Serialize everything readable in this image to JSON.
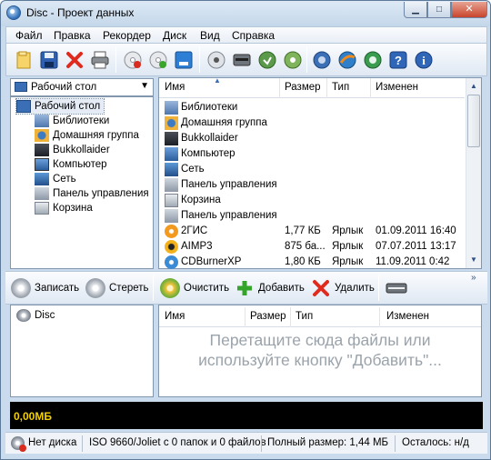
{
  "window": {
    "title": "Disc - Проект данных",
    "min": "▁",
    "max": "□",
    "close": "✕"
  },
  "menu": [
    "Файл",
    "Правка",
    "Рекордер",
    "Диск",
    "Вид",
    "Справка"
  ],
  "toolbar_icons": [
    "new-folder-icon",
    "save-icon",
    "delete-icon",
    "print-icon",
    "burn-disc-icon",
    "blank-disc-icon",
    "drive-icon",
    "disc-info-icon",
    "recorder-icon",
    "copy-disc-icon",
    "rip-disc-icon",
    "settings-icon",
    "web-icon",
    "update-icon",
    "help-icon",
    "info-icon"
  ],
  "location": {
    "selected": "Рабочий стол"
  },
  "tree": [
    {
      "label": "Рабочий стол",
      "icon": "desktop-icon",
      "selected": true
    },
    {
      "label": "Библиотеки",
      "icon": "libraries-icon"
    },
    {
      "label": "Домашняя группа",
      "icon": "homegroup-icon"
    },
    {
      "label": "Bukkollaider",
      "icon": "user-folder-icon"
    },
    {
      "label": "Компьютер",
      "icon": "computer-icon"
    },
    {
      "label": "Сеть",
      "icon": "network-icon"
    },
    {
      "label": "Панель управления",
      "icon": "control-panel-icon"
    },
    {
      "label": "Корзина",
      "icon": "recycle-bin-icon"
    }
  ],
  "file_list": {
    "columns": {
      "name": "Имя",
      "size": "Размер",
      "type": "Тип",
      "modified": "Изменен"
    },
    "rows": [
      {
        "name": "Библиотеки",
        "size": "",
        "type": "",
        "date": "",
        "icon": "libraries-icon"
      },
      {
        "name": "Домашняя группа",
        "size": "",
        "type": "",
        "date": "",
        "icon": "homegroup-icon"
      },
      {
        "name": "Bukkollaider",
        "size": "",
        "type": "",
        "date": "",
        "icon": "user-folder-icon"
      },
      {
        "name": "Компьютер",
        "size": "",
        "type": "",
        "date": "",
        "icon": "computer-icon"
      },
      {
        "name": "Сеть",
        "size": "",
        "type": "",
        "date": "",
        "icon": "network-icon"
      },
      {
        "name": "Панель управления",
        "size": "",
        "type": "",
        "date": "",
        "icon": "control-panel-icon"
      },
      {
        "name": "Корзина",
        "size": "",
        "type": "",
        "date": "",
        "icon": "recycle-bin-icon"
      },
      {
        "name": "Панель управления",
        "size": "",
        "type": "",
        "date": "",
        "icon": "control-panel-icon"
      },
      {
        "name": "2ГИС",
        "size": "1,77 КБ",
        "type": "Ярлык",
        "date": "01.09.2011 16:40",
        "icon": "2gis-icon"
      },
      {
        "name": "AIMP3",
        "size": "875 ба...",
        "type": "Ярлык",
        "date": "07.07.2011 13:17",
        "icon": "aimp-icon"
      },
      {
        "name": "CDBurnerXP",
        "size": "1,80 КБ",
        "type": "Ярлык",
        "date": "11.09.2011 0:42",
        "icon": "cdburnerxp-icon"
      }
    ]
  },
  "compilation_toolbar": {
    "burn": "Записать",
    "erase": "Стереть",
    "clear": "Очистить",
    "add": "Добавить",
    "remove": "Удалить",
    "more": "»"
  },
  "disc_tree": {
    "root": "Disc"
  },
  "disc_list": {
    "columns": {
      "name": "Имя",
      "size": "Размер",
      "type": "Тип",
      "modified": "Изменен"
    },
    "hint_line1": "Перетащите сюда файлы или",
    "hint_line2": "используйте кнопку \"Добавить\"..."
  },
  "capacity": {
    "used": "0,00МБ",
    "fill_fraction": 0
  },
  "status": {
    "disc": "Нет диска",
    "filesystem": "ISO 9660/Joliet с 0 папок и 0 файлов",
    "total": "Полный размер: 1,44 МБ",
    "remaining": "Осталось: н/д"
  }
}
